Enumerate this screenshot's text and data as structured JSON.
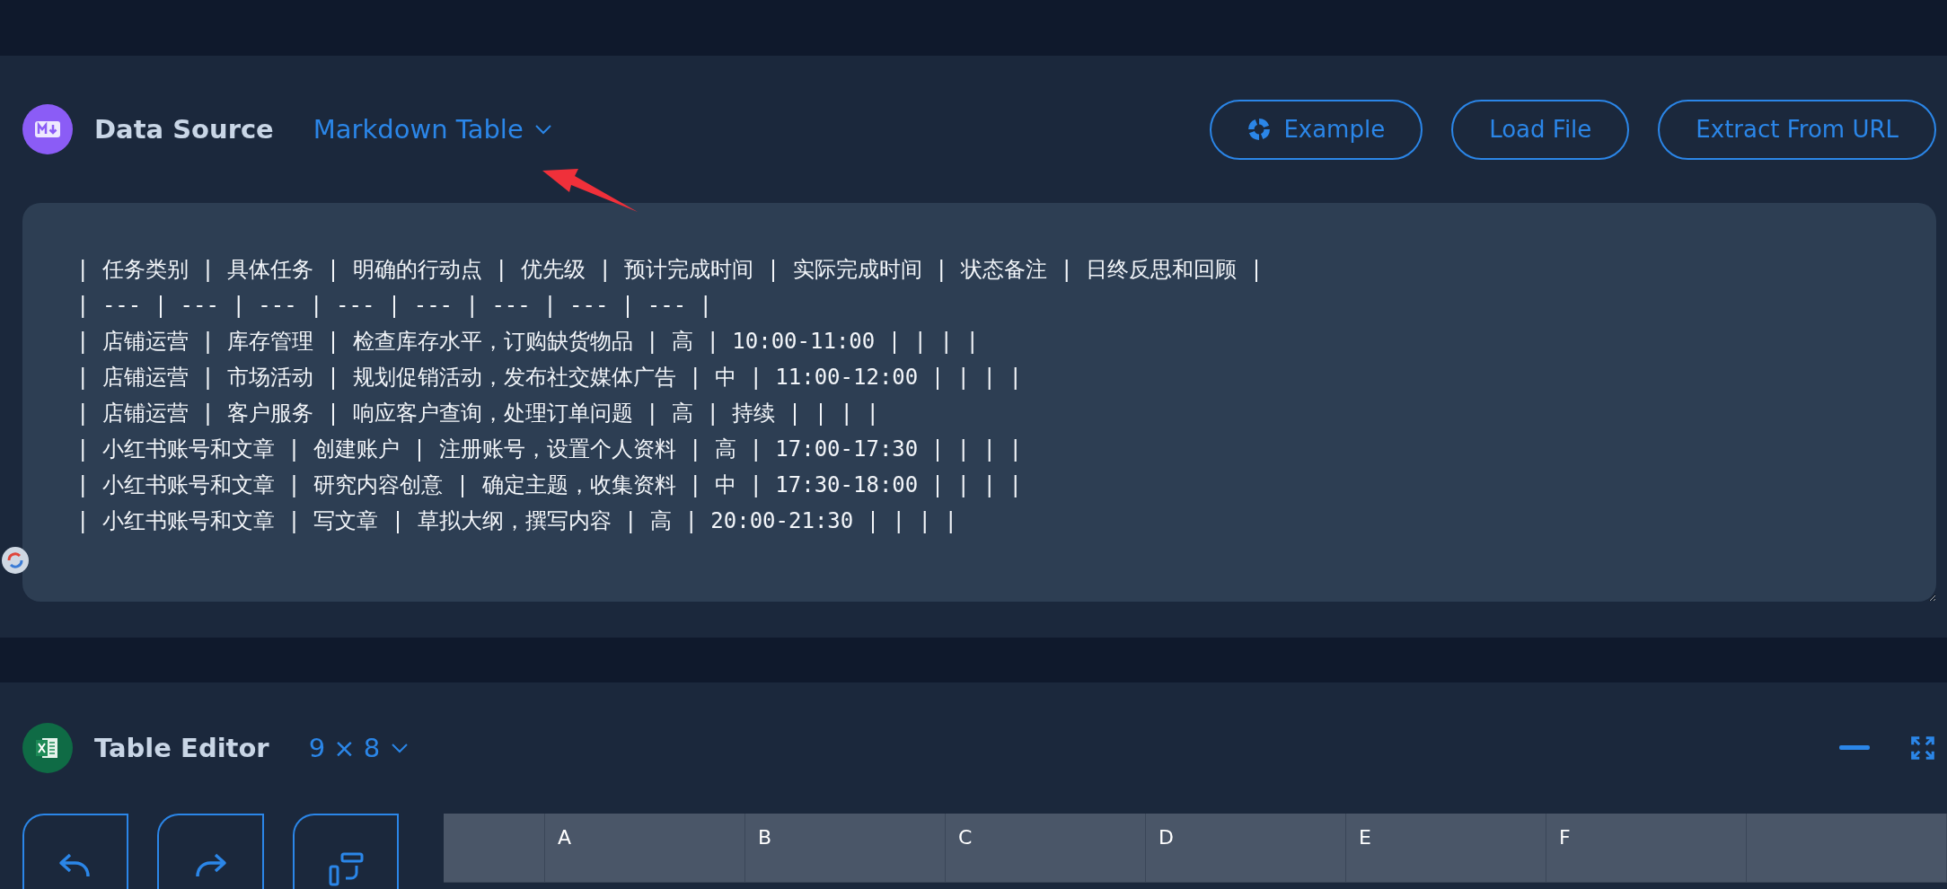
{
  "data_source": {
    "title": "Data Source",
    "format": "Markdown Table",
    "buttons": [
      {
        "label": "Example",
        "kind": "icon"
      },
      {
        "label": "Load File",
        "kind": "plain"
      },
      {
        "label": "Extract From URL",
        "kind": "plain"
      }
    ],
    "editor_lines": [
      "| 任务类别 | 具体任务 | 明确的行动点 | 优先级 | 预计完成时间 | 实际完成时间 | 状态备注 | 日终反思和回顾 |",
      "| --- | --- | --- | --- | --- | --- | --- | --- |",
      "| 店铺运营 | 库存管理 | 检查库存水平，订购缺货物品 | 高 | 10:00-11:00 | | | |",
      "| 店铺运营 | 市场活动 | 规划促销活动，发布社交媒体广告 | 中 | 11:00-12:00 | | | |",
      "| 店铺运营 | 客户服务 | 响应客户查询，处理订单问题 | 高 | 持续 | | | |",
      "| 小红书账号和文章 | 创建账户 | 注册账号，设置个人资料 | 高 | 17:00-17:30 | | | |",
      "| 小红书账号和文章 | 研究内容创意 | 确定主题，收集资料 | 中 | 17:30-18:00 | | | |",
      "| 小红书账号和文章 | 写文章 | 草拟大纲，撰写内容 | 高 | 20:00-21:30 | | | |"
    ]
  },
  "table_editor": {
    "title": "Table Editor",
    "size": "9 × 8",
    "tools": [
      {
        "kind": "undo"
      },
      {
        "kind": "redo"
      },
      {
        "kind": "wrap"
      }
    ],
    "columns": [
      "A",
      "B",
      "C",
      "D",
      "E",
      "F"
    ]
  }
}
